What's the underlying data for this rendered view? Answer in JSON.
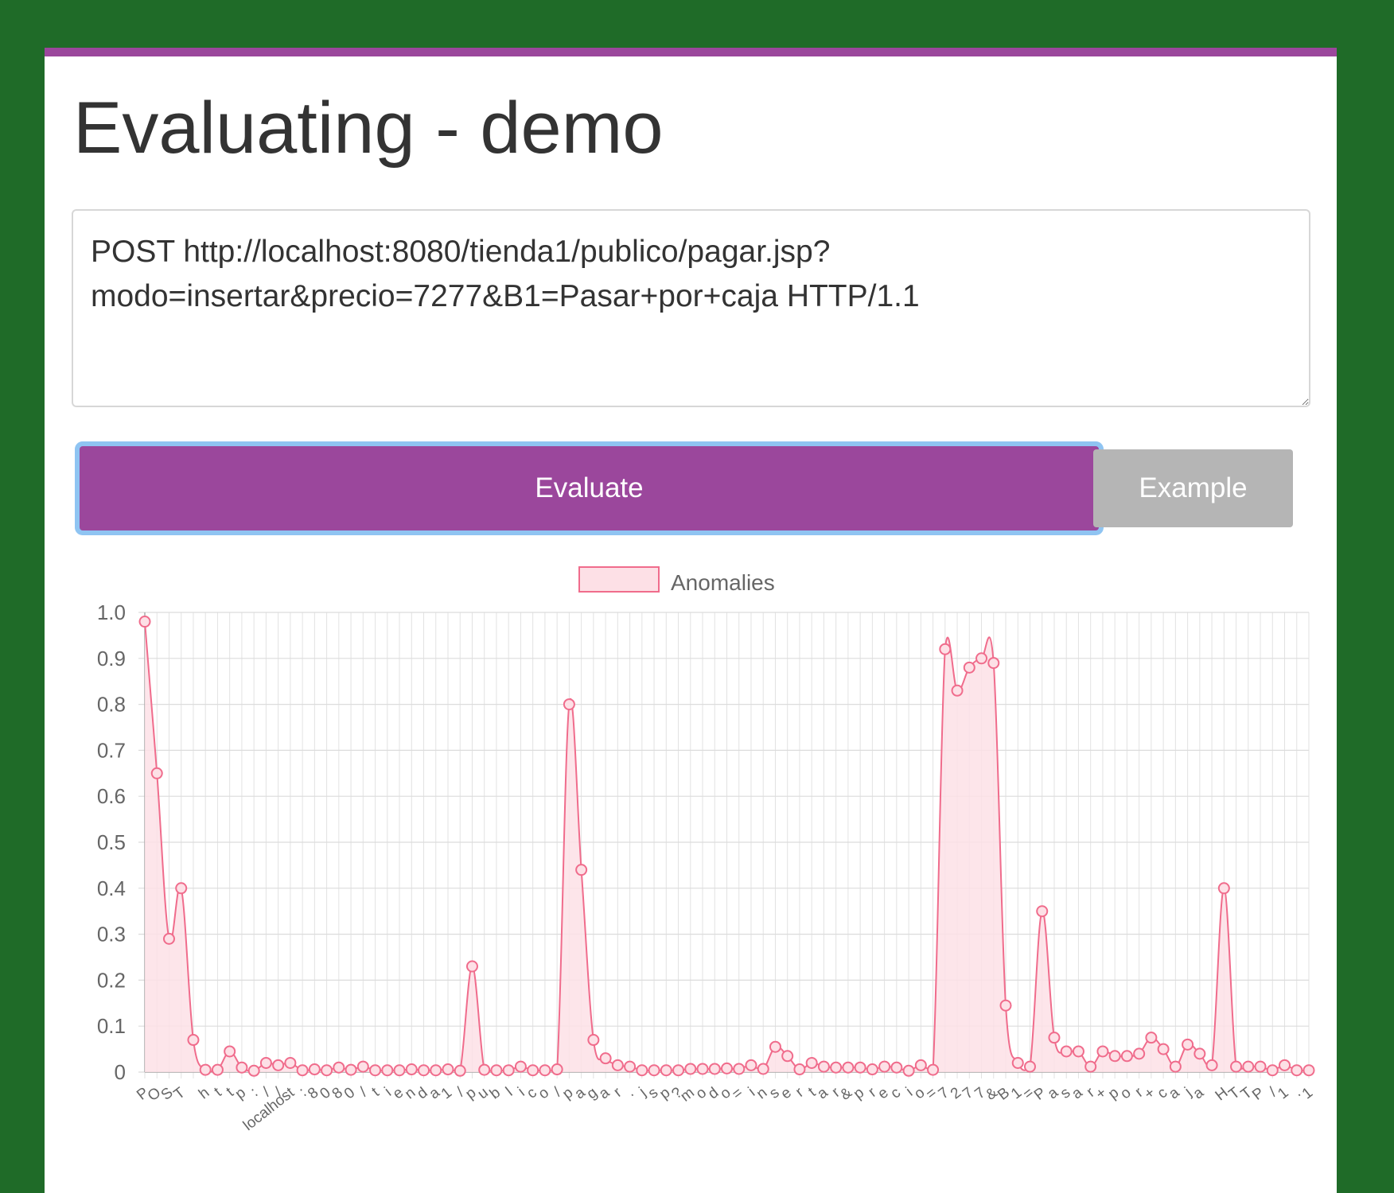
{
  "page": {
    "title": "Evaluating - demo"
  },
  "request": {
    "value": "POST http://localhost:8080/tienda1/publico/pagar.jsp?modo=insertar&precio=7277&B1=Pasar+por+caja HTTP/1.1"
  },
  "buttons": {
    "evaluate": "Evaluate",
    "example": "Example"
  },
  "colors": {
    "background": "#1f6b28",
    "accent": "#9b479c",
    "series_line": "#f06c8c",
    "series_fill": "#fde0e6"
  },
  "chart_data": {
    "type": "line",
    "legend": "Anomalies",
    "ylim": [
      0,
      1.0
    ],
    "yticks": [
      "1.0",
      "0.9",
      "0.8",
      "0.7",
      "0.6",
      "0.5",
      "0.4",
      "0.3",
      "0.2",
      "0.1",
      "0"
    ],
    "grid": true,
    "categories": [
      "P",
      "O",
      "S",
      "T",
      " ",
      "h",
      "t",
      "t",
      "p",
      ":",
      "/",
      "/",
      "localhost",
      ":",
      "8",
      "0",
      "8",
      "0",
      "/",
      "t",
      "i",
      "e",
      "n",
      "d",
      "a",
      "1",
      "/",
      "p",
      "u",
      "b",
      "l",
      "i",
      "c",
      "o",
      "/",
      "p",
      "a",
      "g",
      "a",
      "r",
      ".",
      "j",
      "s",
      "p",
      "?",
      "m",
      "o",
      "d",
      "o",
      "=",
      "i",
      "n",
      "s",
      "e",
      "r",
      "t",
      "a",
      "r",
      "&",
      "p",
      "r",
      "e",
      "c",
      "i",
      "o",
      "=",
      "7",
      "2",
      "7",
      "7",
      "&",
      "B",
      "1",
      "=",
      "P",
      "a",
      "s",
      "a",
      "r",
      "+",
      "p",
      "o",
      "r",
      "+",
      "c",
      "a",
      "j",
      "a",
      " ",
      "H",
      "T",
      "T",
      "P",
      "/",
      "1",
      ".",
      "1"
    ],
    "series": [
      {
        "name": "Anomalies",
        "values": [
          0.98,
          0.65,
          0.29,
          0.4,
          0.07,
          0.005,
          0.005,
          0.045,
          0.01,
          0.003,
          0.02,
          0.015,
          0.02,
          0.004,
          0.006,
          0.004,
          0.01,
          0.005,
          0.012,
          0.004,
          0.004,
          0.004,
          0.006,
          0.004,
          0.004,
          0.006,
          0.003,
          0.23,
          0.005,
          0.004,
          0.004,
          0.012,
          0.004,
          0.004,
          0.006,
          0.8,
          0.44,
          0.07,
          0.03,
          0.015,
          0.012,
          0.004,
          0.004,
          0.004,
          0.004,
          0.007,
          0.007,
          0.007,
          0.008,
          0.007,
          0.015,
          0.007,
          0.055,
          0.035,
          0.006,
          0.02,
          0.012,
          0.01,
          0.01,
          0.01,
          0.006,
          0.012,
          0.01,
          0.003,
          0.015,
          0.005,
          0.92,
          0.83,
          0.88,
          0.9,
          0.89,
          0.145,
          0.02,
          0.012,
          0.35,
          0.075,
          0.045,
          0.045,
          0.012,
          0.045,
          0.035,
          0.035,
          0.04,
          0.075,
          0.05,
          0.012,
          0.06,
          0.04,
          0.015,
          0.4,
          0.012,
          0.012,
          0.012,
          0.004,
          0.015,
          0.004,
          0.004
        ]
      }
    ]
  }
}
